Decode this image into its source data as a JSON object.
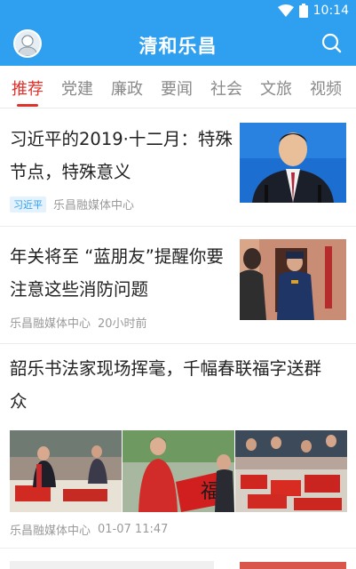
{
  "status_bar": {
    "time": "10:14"
  },
  "header": {
    "title": "清和乐昌"
  },
  "tabs": [
    {
      "label": "推荐",
      "active": true
    },
    {
      "label": "党建"
    },
    {
      "label": "廉政"
    },
    {
      "label": "要闻"
    },
    {
      "label": "社会"
    },
    {
      "label": "文旅"
    },
    {
      "label": "视频"
    }
  ],
  "articles": [
    {
      "line1": "习近平的2019·十二月：特殊",
      "line2": "节点，特殊意义",
      "tag": "习近平",
      "source": "乐昌融媒体中心",
      "time": ""
    },
    {
      "line1": "年关将至 “蓝朋友”提醒你要",
      "line2": "注意这些消防问题",
      "source": "乐昌融媒体中心",
      "time": "20小时前"
    },
    {
      "line1": "韶乐书法家现场挥毫，千幅春联福字送群",
      "line2": "众",
      "source": "乐昌融媒体中心",
      "time": "01-07 11:47"
    }
  ],
  "colors": {
    "brand_blue": "#2f9ff0",
    "accent_red": "#e0312b",
    "tag_bg": "#e3f2fd"
  }
}
